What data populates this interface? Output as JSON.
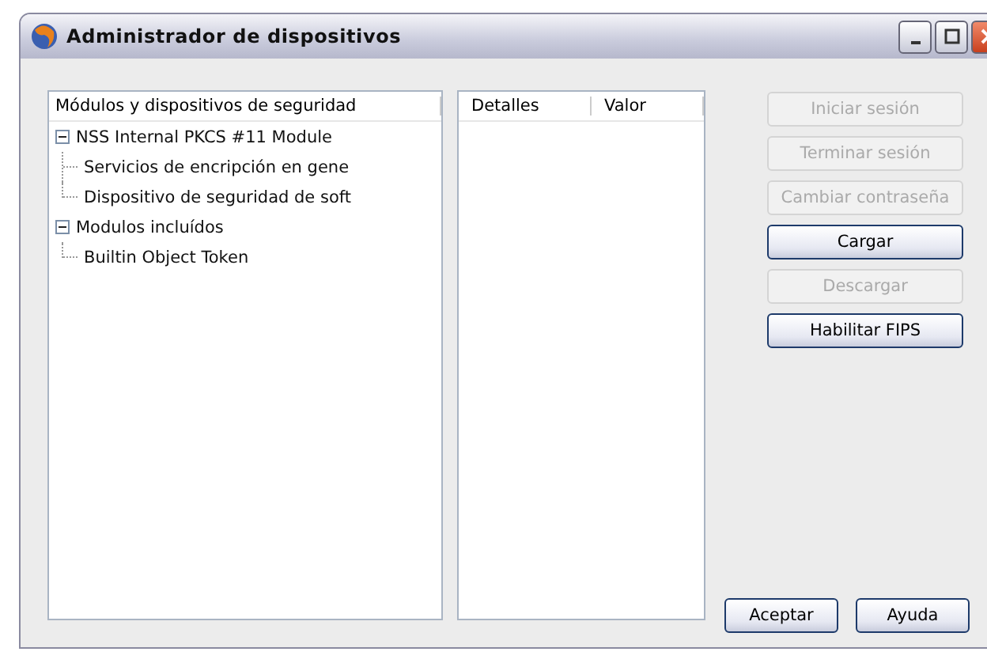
{
  "window": {
    "title": "Administrador de dispositivos"
  },
  "tree": {
    "header": "Módulos y dispositivos de seguridad",
    "items": [
      {
        "label": "NSS Internal PKCS #11 Module",
        "expanded": true,
        "children": [
          {
            "label": "Servicios de encripción en gene"
          },
          {
            "label": "Dispositivo de seguridad de soft"
          }
        ]
      },
      {
        "label": "Modulos incluídos",
        "expanded": true,
        "children": [
          {
            "label": "Builtin Object Token"
          }
        ]
      }
    ]
  },
  "details": {
    "columns": [
      "Detalles",
      "Valor"
    ]
  },
  "actions": [
    {
      "label": "Iniciar sesión",
      "disabled": true
    },
    {
      "label": "Terminar sesión",
      "disabled": true
    },
    {
      "label": "Cambiar contraseña",
      "disabled": true
    },
    {
      "label": "Cargar",
      "disabled": false
    },
    {
      "label": "Descargar",
      "disabled": true
    },
    {
      "label": "Habilitar FIPS",
      "disabled": false
    }
  ],
  "footer_buttons": [
    "Aceptar",
    "Ayuda"
  ]
}
